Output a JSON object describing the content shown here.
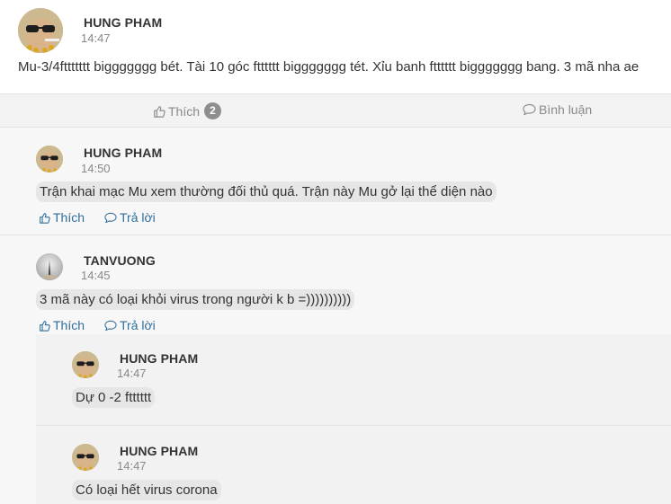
{
  "post": {
    "author": "HUNG PHAM",
    "time": "14:47",
    "text": "Mu-3/4fttttttt biggggggg bét. Tài 10 góc ftttttt biggggggg tét. Xỉu banh ftttttt biggggggg bang. 3 mã nha ae"
  },
  "actions": {
    "like_label": "Thích",
    "like_count": "2",
    "comment_label": "Bình luận"
  },
  "comments": [
    {
      "author": "HUNG PHAM",
      "time": "14:50",
      "text": "Trận khai mạc Mu xem thường đối thủ quá. Trận này Mu gở lại thể diện nào",
      "like_label": "Thích",
      "reply_label": "Trả lời"
    },
    {
      "author": "TANVUONG",
      "time": "14:45",
      "text": "3 mã này có loại khỏi virus trong người k b =))))))))))",
      "like_label": "Thích",
      "reply_label": "Trả lời",
      "replies": [
        {
          "author": "HUNG PHAM",
          "time": "14:47",
          "text": "Dự 0 -2 ftttttt"
        },
        {
          "author": "HUNG PHAM",
          "time": "14:47",
          "text": "Có loại hết virus corona"
        }
      ]
    }
  ],
  "icons": {
    "like": "thumbs-up-icon",
    "comment": "speech-bubble-icon"
  },
  "colors": {
    "link": "#2f6e9c",
    "badge": "#8e8e8e",
    "bubble": "#e6e6e6"
  }
}
